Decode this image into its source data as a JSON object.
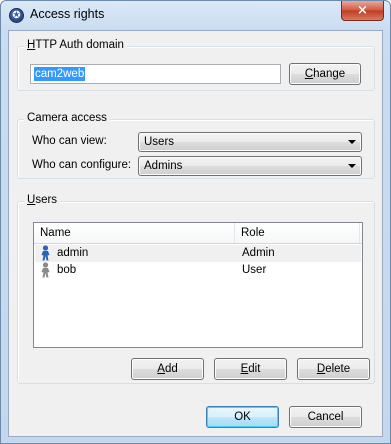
{
  "window": {
    "title": "Access rights",
    "close_glyph": "×",
    "icon": "accessibility-icon"
  },
  "auth": {
    "legend": "HTTP Auth domain",
    "legend_mnemonic": "H",
    "legend_rest": "TTP Auth domain",
    "domain_value": "cam2web",
    "change_label": "Change",
    "change_mnemonic": "C",
    "change_rest": "hange"
  },
  "camera": {
    "legend": "Camera access",
    "view_label": "Who can view:",
    "view_value": "Users",
    "configure_label": "Who can configure:",
    "configure_value": "Admins"
  },
  "users": {
    "legend": "Users",
    "legend_mnemonic": "U",
    "legend_rest": "sers",
    "columns": [
      "Name",
      "Role"
    ],
    "rows": [
      {
        "name": "admin",
        "role": "Admin",
        "icon": "admin-user-icon",
        "color": "#2a62b8"
      },
      {
        "name": "bob",
        "role": "User",
        "icon": "user-icon",
        "color": "#7a7a7a"
      }
    ],
    "add_mnemonic": "A",
    "add_rest": "dd",
    "edit_mnemonic": "E",
    "edit_rest": "dit",
    "delete_mnemonic": "D",
    "delete_rest": "elete"
  },
  "footer": {
    "ok_label": "OK",
    "cancel_label": "Cancel"
  }
}
